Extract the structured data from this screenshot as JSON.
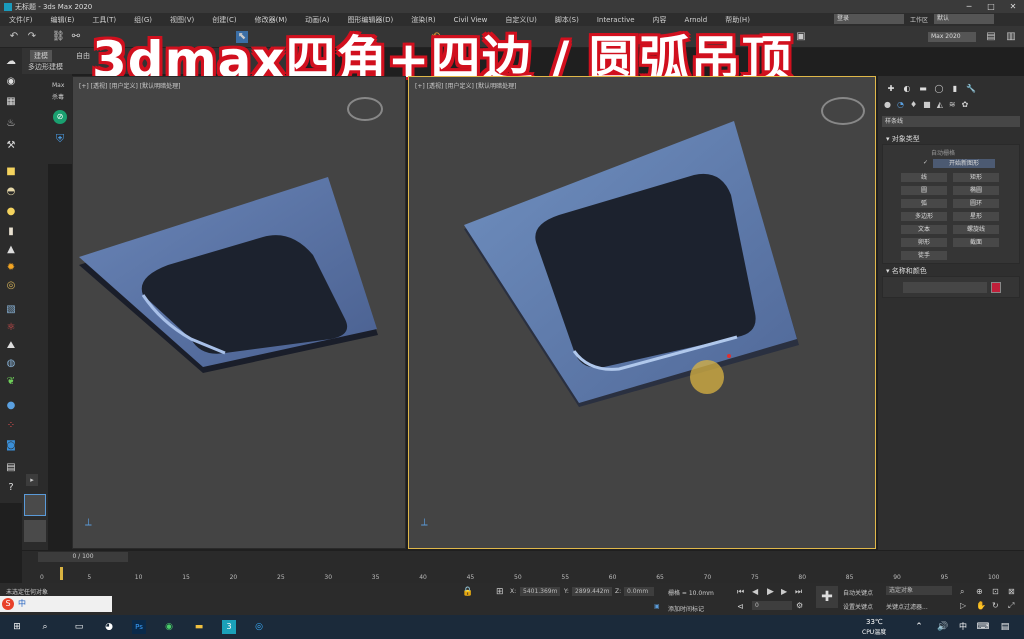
{
  "window": {
    "title": "无标题 - 3ds Max 2020"
  },
  "menu": [
    "文件(F)",
    "编辑(E)",
    "工具(T)",
    "组(G)",
    "视图(V)",
    "创建(C)",
    "修改器(M)",
    "动画(A)",
    "图形编辑器(D)",
    "渲染(R)",
    "Civil View",
    "自定义(U)",
    "脚本(S)",
    "Interactive",
    "内容",
    "Arnold",
    "帮助(H)"
  ],
  "menu_right": {
    "workspace_label": "工作区",
    "workspace_value": "默认",
    "login": "登录",
    "version": "Max 2020"
  },
  "ribbon": {
    "tab1": "建模",
    "tab2": "自由",
    "sub": "多边形建模"
  },
  "overlay_title": "3dmax四角+四边 / 圆弧吊顶",
  "scene_explorer": {
    "label1": "Max",
    "label2": "杀毒"
  },
  "viewports": {
    "left_label": "[+] [透视] [用户定义] [默认明暗处理]",
    "right_label": "[+] [透视] [用户定义] [默认明暗处理]"
  },
  "command_panel": {
    "dropdown": "样条线",
    "object_type_header": "对象类型",
    "autogrid": "自动栅格",
    "start_new_shape": "开始新图形",
    "buttons": [
      "线",
      "矩形",
      "圆",
      "椭圆",
      "弧",
      "圆环",
      "多边形",
      "星形",
      "文本",
      "螺旋线",
      "卵形",
      "截面",
      "徒手"
    ],
    "name_color_header": "名称和颜色",
    "object_color": "#c0203a"
  },
  "timeline": {
    "frame_readout": "0 / 100",
    "ticks": [
      "0",
      "5",
      "10",
      "15",
      "20",
      "25",
      "30",
      "35",
      "40",
      "45",
      "50",
      "55",
      "60",
      "65",
      "70",
      "75",
      "80",
      "85",
      "90",
      "95",
      "100"
    ]
  },
  "status": {
    "prompt": "未选定任何对象",
    "x_label": "X:",
    "x_value": "5401.369m",
    "y_label": "Y:",
    "y_value": "2899.442m",
    "z_label": "Z:",
    "z_value": "0.0mm",
    "grid": "栅格 = 10.0mm",
    "add_tag": "添加时间标记",
    "auto_key": "自动关键点",
    "selected_obj": "选定对象",
    "set_key": "设置关键点",
    "key_filter": "关键点过滤器...",
    "frame_field": "0"
  },
  "taskbar": {
    "temp": "33℃",
    "cpu_label": "CPU温度",
    "ime": "中"
  }
}
